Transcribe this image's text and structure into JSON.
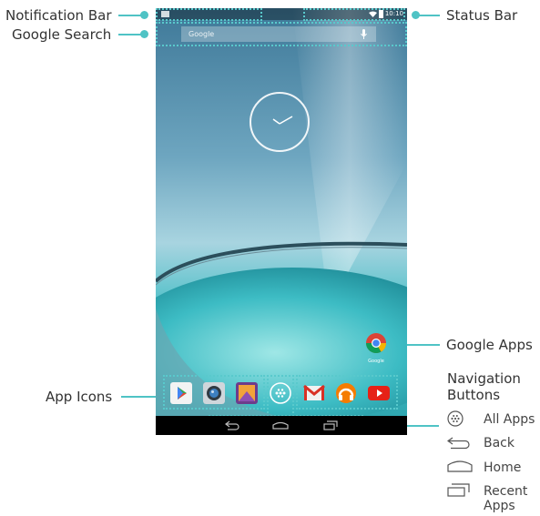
{
  "callouts": {
    "notification_bar": "Notification Bar",
    "google_search": "Google Search",
    "status_bar": "Status Bar",
    "google_apps": "Google Apps",
    "app_icons": "App Icons",
    "navigation_buttons_line1": "Navigation",
    "navigation_buttons_line2": "Buttons"
  },
  "screen": {
    "status_time": "10:10",
    "search_placeholder": "Google",
    "google_folder_label": "Google"
  },
  "legend": {
    "all_apps": "All Apps",
    "back": "Back",
    "home": "Home",
    "recent_apps_line1": "Recent",
    "recent_apps_line2": "Apps"
  },
  "icons": [
    "play-store-icon",
    "camera-icon",
    "gallery-icon",
    "all-apps-icon",
    "gmail-icon",
    "play-music-icon",
    "youtube-icon",
    "back-icon",
    "home-icon",
    "recent-apps-icon",
    "chrome-icon",
    "microphone-icon"
  ],
  "colors": {
    "accent": "#4fc3c5",
    "navbar": "#000000"
  }
}
